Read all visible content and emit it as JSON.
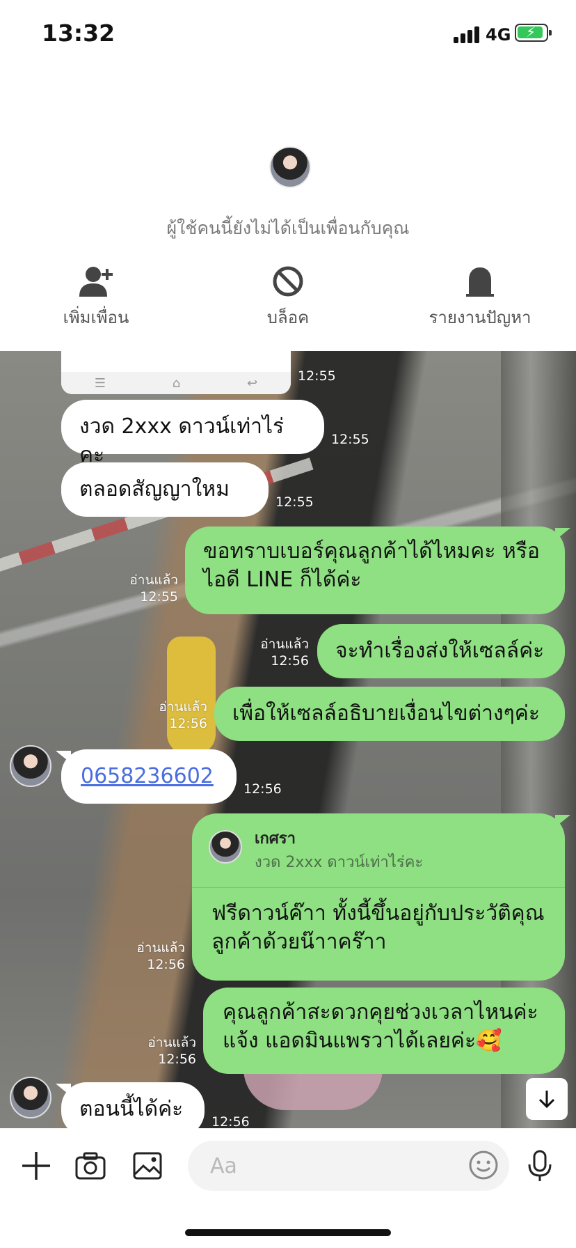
{
  "status_bar": {
    "time": "13:32",
    "network": "4G"
  },
  "profile": {
    "notice": "ผู้ใช้คนนี้ยังไม่ได้เป็นเพื่อนกับคุณ",
    "actions": [
      {
        "label": "เพิ่มเพื่อน",
        "icon": "add-friend-icon"
      },
      {
        "label": "บล็อค",
        "icon": "block-icon"
      },
      {
        "label": "รายงานปัญหา",
        "icon": "report-icon"
      }
    ]
  },
  "chat": {
    "image_time": "12:55",
    "messages": [
      {
        "from": "them",
        "text": "งวด 2xxx ดาวน์เท่าไร่คะ",
        "time": "12:55"
      },
      {
        "from": "them",
        "text": "ตลอดสัญญาใหม",
        "time": "12:55"
      },
      {
        "from": "me",
        "text": "ขอทราบเบอร์คุณลูกค้าได้ไหมคะ หรือ ไอดี LINE ก็ได้ค่ะ",
        "read": "อ่านแล้ว",
        "time": "12:55"
      },
      {
        "from": "me",
        "text": "จะทำเรื่องส่งให้เซลล์ค่ะ",
        "read": "อ่านแล้ว",
        "time": "12:56"
      },
      {
        "from": "me",
        "text": "เพื่อให้เซลล์อธิบายเงื่อนไขต่างๆค่ะ",
        "read": "อ่านแล้ว",
        "time": "12:56"
      },
      {
        "from": "them",
        "text": "0658236602",
        "time": "12:56"
      },
      {
        "from": "me",
        "reply_name": "เกศรา",
        "reply_text": "งวด 2xxx ดาวน์เท่าไร่คะ",
        "text": "ฟรีดาวน์ค๊าา ทั้งนี้ขึ้นอยู่กับประวัติคุณลูกค้าด้วยน๊าาคร๊าา",
        "read": "อ่านแล้ว",
        "time": "12:56"
      },
      {
        "from": "me",
        "text": "คุณลูกค้าสะดวกคุยช่วงเวลาไหนค่ะแจ้ง แอดมินแพรวาได้เลยค่ะ🥰",
        "read": "อ่านแล้ว",
        "time": "12:56"
      },
      {
        "from": "them",
        "text": "ตอนนี้ได้ค่ะ",
        "time": "12:56"
      }
    ]
  },
  "input": {
    "placeholder": "Aa"
  }
}
